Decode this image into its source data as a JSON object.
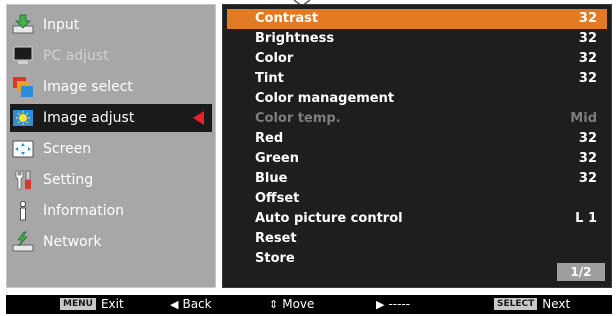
{
  "left_menu": {
    "items": [
      {
        "label": "Input",
        "icon": "input-icon"
      },
      {
        "label": "PC adjust",
        "icon": "pc-adjust-icon"
      },
      {
        "label": "Image select",
        "icon": "image-select-icon"
      },
      {
        "label": "Image adjust",
        "icon": "image-adjust-icon"
      },
      {
        "label": "Screen",
        "icon": "screen-icon"
      },
      {
        "label": "Setting",
        "icon": "setting-icon"
      },
      {
        "label": "Information",
        "icon": "information-icon"
      },
      {
        "label": "Network",
        "icon": "network-icon"
      }
    ],
    "selected_index": 3
  },
  "image_adjust": {
    "rows": [
      {
        "label": "Contrast",
        "value": "32"
      },
      {
        "label": "Brightness",
        "value": "32"
      },
      {
        "label": "Color",
        "value": "32"
      },
      {
        "label": "Tint",
        "value": "32"
      },
      {
        "label": "Color management",
        "value": ""
      },
      {
        "label": "Color temp.",
        "value": "Mid"
      },
      {
        "label": "Red",
        "value": "32"
      },
      {
        "label": "Green",
        "value": "32"
      },
      {
        "label": "Blue",
        "value": "32"
      },
      {
        "label": "Offset",
        "value": ""
      },
      {
        "label": "Auto picture control",
        "value": "L 1"
      },
      {
        "label": "Reset",
        "value": ""
      },
      {
        "label": "Store",
        "value": ""
      }
    ],
    "highlighted_index": 0,
    "disabled_index": 5,
    "page": "1/2"
  },
  "bottom_bar": {
    "menu_key": "MENU",
    "exit": "Exit",
    "back": "Back",
    "move": "Move",
    "dashes": "-----",
    "select_key": "SELECT",
    "next": "Next"
  },
  "colors": {
    "highlight": "#e07b24",
    "selection_arrow": "#e8202a",
    "left_panel": "#a7a7a7",
    "right_panel": "#1e1e1e"
  }
}
